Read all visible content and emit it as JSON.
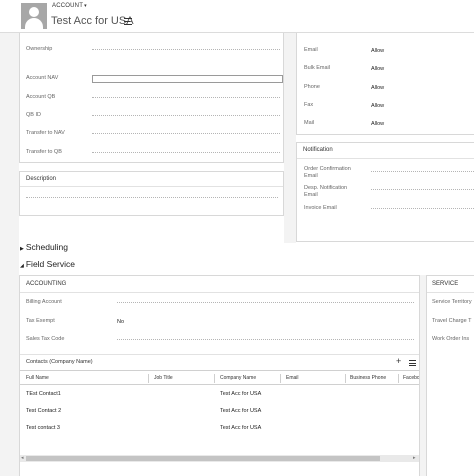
{
  "header": {
    "entity_label": "ACCOUNT",
    "caret": "▾",
    "record_title": "Test Acc for USA"
  },
  "left_details": {
    "fields": [
      {
        "label": "Ownership",
        "value": ""
      },
      {
        "label": "Account NAV",
        "value": ""
      },
      {
        "label": "Account QB",
        "value": ""
      },
      {
        "label": "QB ID",
        "value": ""
      },
      {
        "label": "Transfer to NAV",
        "value": ""
      },
      {
        "label": "Transfer to QB",
        "value": ""
      }
    ]
  },
  "description": {
    "title": "Description"
  },
  "contact_prefs": {
    "fields": [
      {
        "label": "Email",
        "value": "Allow"
      },
      {
        "label": "Bulk Email",
        "value": "Allow"
      },
      {
        "label": "Phone",
        "value": "Allow"
      },
      {
        "label": "Fax",
        "value": "Allow"
      },
      {
        "label": "Mail",
        "value": "Allow"
      }
    ]
  },
  "notification": {
    "title": "Notification",
    "fields": [
      {
        "label": "Order Confirmation Email",
        "line1": "Order Confirmation",
        "line2": "Email"
      },
      {
        "label": "Desp. Notification Email",
        "line1": "Desp. Notification",
        "line2": "Email"
      },
      {
        "label": "Invoice Email",
        "line1": "Invoice Email",
        "line2": ""
      }
    ]
  },
  "sections": {
    "scheduling": "Scheduling",
    "field_service": "Field Service"
  },
  "accounting": {
    "title": "ACCOUNTING",
    "fields": [
      {
        "label": "Billing Account",
        "value": ""
      },
      {
        "label": "Tax Exempt",
        "value": "No"
      },
      {
        "label": "Sales Tax Code",
        "value": ""
      }
    ]
  },
  "service": {
    "title": "SERVICE",
    "fields": [
      "Service Territory",
      "Travel Charge T",
      "Work Order Ins"
    ]
  },
  "contacts": {
    "title": "Contacts (Company Name)",
    "columns": [
      "Full Name",
      "Job Title",
      "Company Name",
      "Email",
      "Business Phone",
      "Facebo"
    ],
    "rows": [
      {
        "full_name": "TEst Contact1",
        "company": "Test Acc for USA"
      },
      {
        "full_name": "Test Contact 2",
        "company": "Test Acc for USA"
      },
      {
        "full_name": "Test contact 3",
        "company": "Test Acc for USA"
      }
    ]
  }
}
